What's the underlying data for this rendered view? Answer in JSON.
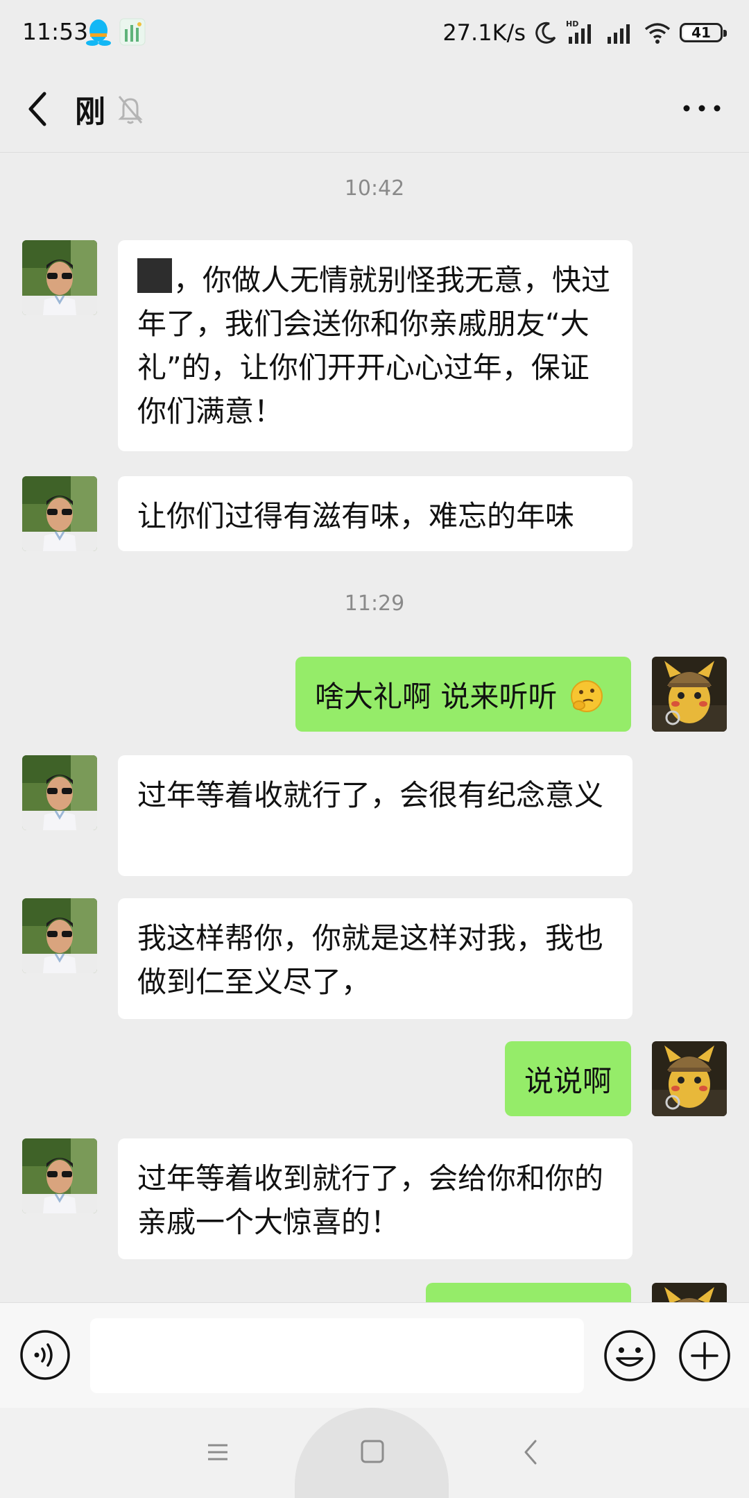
{
  "status_bar": {
    "time": "11:53",
    "net_speed": "27.1K/s",
    "battery": "41",
    "icons": [
      "qq-icon",
      "app-icon",
      "moon-icon",
      "hd-signal-icon",
      "signal-icon",
      "wifi-icon",
      "battery-icon"
    ]
  },
  "header": {
    "title": "刚",
    "back_icon": "chevron-left-icon",
    "mute_icon": "bell-off-icon",
    "more_icon": "ellipsis-icon"
  },
  "messages": {
    "ts1": "10:42",
    "m1_text": "，你做人无情就别怪我无意，快过年了，我们会送你和你亲戚朋友“大礼”的，让你们开开心心过年，保证你们满意！",
    "m2_text": "让你们过得有滋有味，难忘的年味",
    "ts2": "11:29",
    "m3_text": "啥大礼啊 说来听听",
    "m4_text": "过年等着收就行了，会很有纪念意义",
    "m5_text": "我这样帮你，你就是这样对我，我也做到仁至义尽了，",
    "m6_text": "说说啊",
    "m7_text": "过年等着收到就行了，会给你和你的亲戚一个大惊喜的！"
  },
  "input_bar": {
    "voice_icon": "voice-icon",
    "emoji_icon": "smiley-icon",
    "plus_icon": "plus-icon",
    "value": ""
  },
  "colors": {
    "background": "#ededed",
    "outgoing_bubble": "#95ec69",
    "incoming_bubble": "#ffffff"
  }
}
